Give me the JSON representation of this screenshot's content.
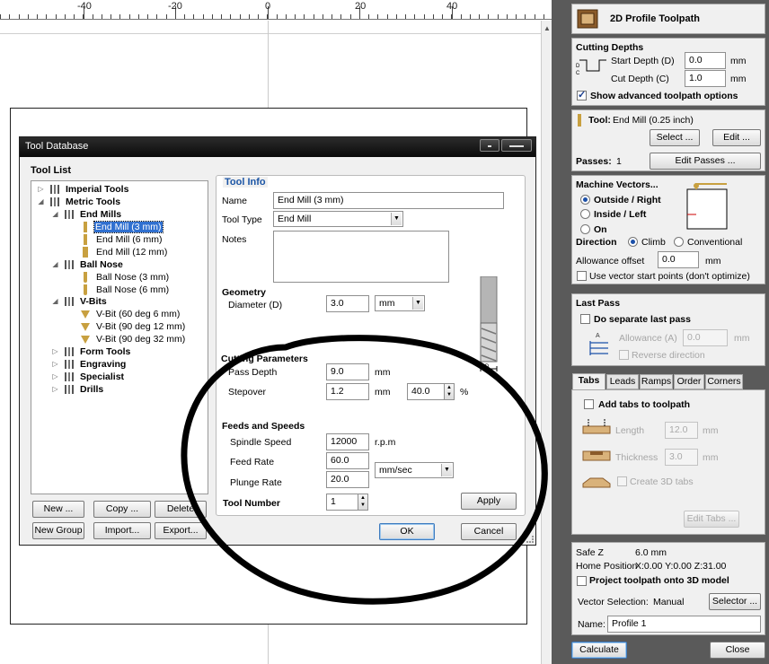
{
  "ruler": {
    "labels": [
      "-40",
      "-20",
      "0",
      "20",
      "40"
    ]
  },
  "dialog": {
    "title": "Tool Database",
    "tool_list_title": "Tool List",
    "tree": {
      "imperial": "Imperial Tools",
      "metric": "Metric Tools",
      "end_mills": "End Mills",
      "em_3": "End Mill (3 mm)",
      "em_6": "End Mill (6 mm)",
      "em_12": "End Mill (12 mm)",
      "ball_nose": "Ball Nose",
      "bn_3": "Ball Nose (3 mm)",
      "bn_6": "Ball Nose (6 mm)",
      "vbits": "V-Bits",
      "vb_60": "V-Bit (60 deg 6 mm)",
      "vb_90_12": "V-Bit (90 deg 12 mm)",
      "vb_90_32": "V-Bit (90 deg 32 mm)",
      "form_tools": "Form Tools",
      "engraving": "Engraving",
      "specialist": "Specialist",
      "drills": "Drills"
    },
    "buttons": {
      "new": "New ...",
      "copy": "Copy ...",
      "delete": "Delete",
      "new_group": "New Group",
      "import": "Import...",
      "export": "Export...",
      "apply": "Apply",
      "ok": "OK",
      "cancel": "Cancel"
    },
    "tool_info": {
      "title": "Tool Info",
      "name_label": "Name",
      "name_value": "End Mill (3 mm)",
      "type_label": "Tool Type",
      "type_value": "End Mill",
      "notes_label": "Notes"
    },
    "geometry": {
      "title": "Geometry",
      "diameter_label": "Diameter (D)",
      "diameter_value": "3.0",
      "unit": "mm"
    },
    "cutting": {
      "title": "Cutting Parameters",
      "pass_depth_label": "Pass Depth",
      "pass_depth_value": "9.0",
      "pass_depth_unit": "mm",
      "stepover_label": "Stepover",
      "stepover_value": "1.2",
      "stepover_unit": "mm",
      "stepover_pct": "40.0",
      "pct_sign": "%"
    },
    "feeds": {
      "title": "Feeds and Speeds",
      "spindle_label": "Spindle Speed",
      "spindle_value": "12000",
      "spindle_unit": "r.p.m",
      "feed_label": "Feed Rate",
      "feed_value": "60.0",
      "plunge_label": "Plunge Rate",
      "plunge_value": "20.0",
      "rate_unit": "mm/sec"
    },
    "tool_number": {
      "label": "Tool Number",
      "value": "1"
    }
  },
  "panel": {
    "header_title": "2D Profile Toolpath",
    "cutting_depths": {
      "title": "Cutting Depths",
      "start_label": "Start Depth (D)",
      "start_value": "0.0",
      "cut_label": "Cut Depth (C)",
      "cut_value": "1.0",
      "unit": "mm",
      "advanced_label": "Show advanced toolpath options"
    },
    "tool": {
      "label": "Tool:",
      "value": "End Mill (0.25 inch)",
      "select": "Select ...",
      "edit": "Edit ...",
      "passes_label": "Passes:",
      "passes_value": "1",
      "edit_passes": "Edit Passes ..."
    },
    "machine_vectors": {
      "title": "Machine Vectors...",
      "outside": "Outside / Right",
      "inside": "Inside / Left",
      "on": "On",
      "direction_label": "Direction",
      "climb": "Climb",
      "conventional": "Conventional",
      "allowance_label": "Allowance offset",
      "allowance_value": "0.0",
      "unit": "mm",
      "start_points_label": "Use vector start points (don't optimize)"
    },
    "last_pass": {
      "title": "Last Pass",
      "separate_label": "Do separate last pass",
      "allowance_label": "Allowance (A)",
      "allowance_value": "0.0",
      "unit": "mm",
      "reverse_label": "Reverse direction"
    },
    "tabs": [
      "Tabs",
      "Leads",
      "Ramps",
      "Order",
      "Corners"
    ],
    "tabs_section": {
      "add_label": "Add tabs to toolpath",
      "length_label": "Length",
      "length_value": "12.0",
      "thickness_label": "Thickness",
      "thickness_value": "3.0",
      "unit": "mm",
      "create3d_label": "Create 3D tabs",
      "edit_tabs": "Edit Tabs ..."
    },
    "bottom": {
      "safe_z_label": "Safe Z",
      "safe_z_value": "6.0 mm",
      "home_label": "Home Position",
      "home_value": "X:0.00 Y:0.00 Z:31.00",
      "project_label": "Project toolpath onto 3D model",
      "vector_sel_label": "Vector Selection:",
      "vector_sel_value": "Manual",
      "selector": "Selector ...",
      "name_label": "Name:",
      "name_value": "Profile 1"
    },
    "calculate": "Calculate",
    "close": "Close"
  }
}
